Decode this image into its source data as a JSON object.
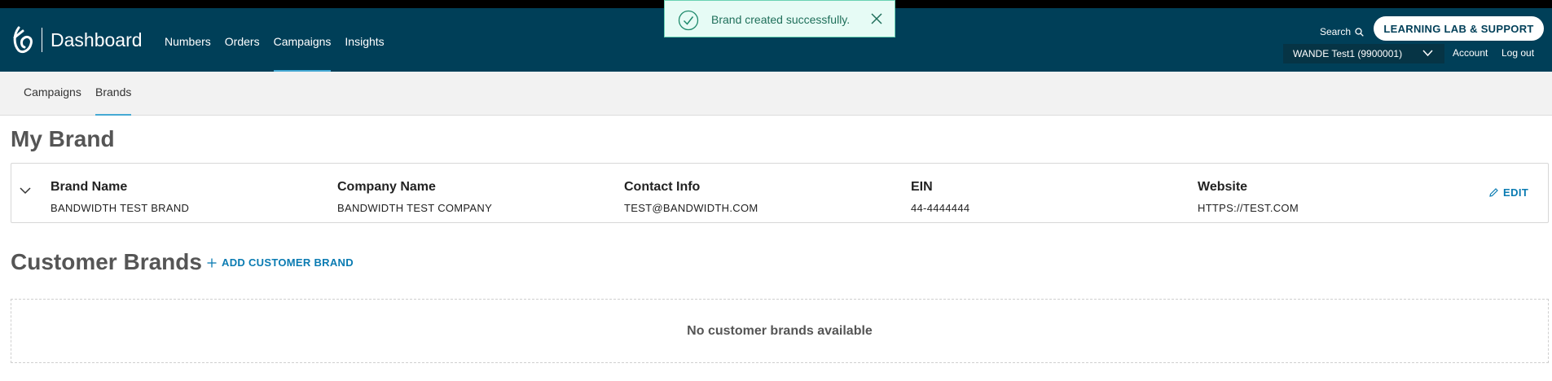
{
  "header": {
    "title": "Dashboard",
    "nav": [
      {
        "label": "Numbers"
      },
      {
        "label": "Orders"
      },
      {
        "label": "Campaigns",
        "active": true
      },
      {
        "label": "Insights"
      }
    ],
    "search_label": "Search",
    "learn_label": "LEARNING LAB & SUPPORT",
    "account_select": "WANDE Test1 (9900001)",
    "account_label": "Account",
    "logout_label": "Log out"
  },
  "toast": {
    "message": "Brand created successfully."
  },
  "subnav": [
    {
      "label": "Campaigns"
    },
    {
      "label": "Brands",
      "active": true
    }
  ],
  "my_brand": {
    "heading": "My Brand",
    "columns": [
      {
        "label": "Brand Name",
        "value": "BANDWIDTH TEST BRAND"
      },
      {
        "label": "Company Name",
        "value": "BANDWIDTH TEST COMPANY"
      },
      {
        "label": "Contact Info",
        "value": "TEST@BANDWIDTH.COM"
      },
      {
        "label": "EIN",
        "value": "44-4444444"
      },
      {
        "label": "Website",
        "value": "HTTPS://TEST.COM"
      }
    ],
    "edit_label": "EDIT"
  },
  "customer_brands": {
    "heading": "Customer Brands",
    "add_label": "ADD CUSTOMER BRAND",
    "empty_message": "No customer brands available"
  },
  "colors": {
    "header_bg": "#003f58",
    "accent": "#45a9d4",
    "link": "#0a7bb2",
    "toast_bg": "#e6fbf5"
  }
}
